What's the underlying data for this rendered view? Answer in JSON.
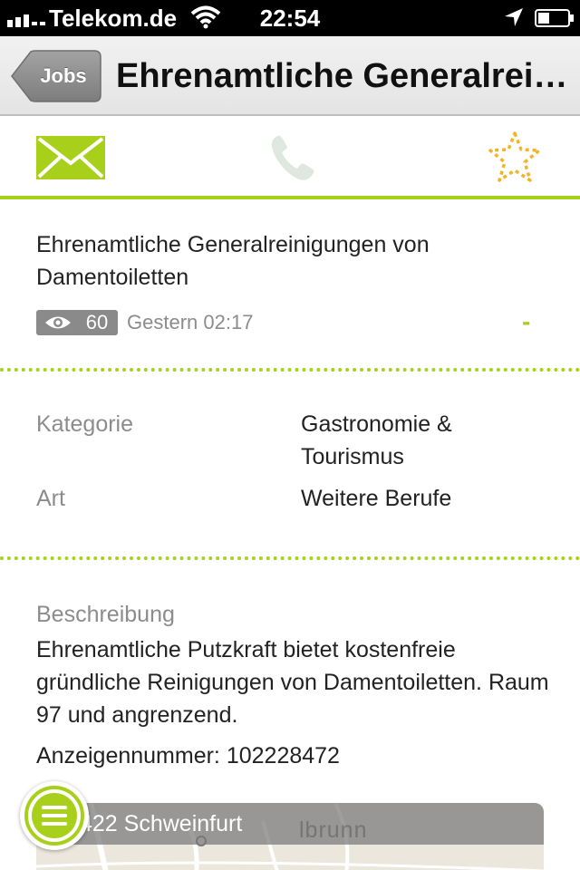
{
  "status_bar": {
    "carrier": "Telekom.de",
    "time": "22:54"
  },
  "nav": {
    "back_label": "Jobs",
    "title": "Ehrenamtliche Generalreinigungen von Damentoiletten"
  },
  "actions": {
    "mail_icon": "envelope-icon",
    "phone_icon": "phone-icon",
    "favorite_icon": "star-outline-icon"
  },
  "listing": {
    "title": "Ehrenamtliche Generalreinigungen von Damentoiletten",
    "views": "60",
    "posted": "Gestern 02:17",
    "status": "-"
  },
  "details": [
    {
      "label": "Kategorie",
      "value": "Gastronomie & Tourismus"
    },
    {
      "label": "Art",
      "value": "Weitere Berufe"
    }
  ],
  "description": {
    "label": "Beschreibung",
    "text": "Ehrenamtliche Putzkraft bietet kostenfreie gründliche Reinigungen von Damentoiletten. Raum 97 und angrenzend.",
    "ad_number": "Anzeigennummer: 102228472"
  },
  "map": {
    "location": "422 Schweinfurt",
    "place_label": "lbrunn"
  },
  "colors": {
    "accent": "#a8cf1a",
    "star": "#f0b429",
    "back_button": "#8e8e8e",
    "badge": "#8a8a8a"
  }
}
